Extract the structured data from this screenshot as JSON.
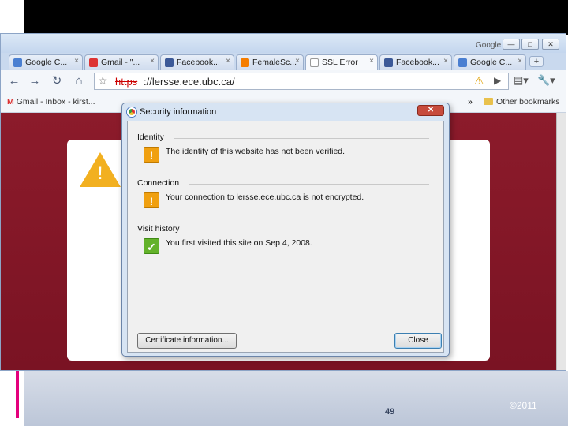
{
  "slide": {
    "number": "49",
    "copyright": "©2011"
  },
  "window": {
    "title_label": "Google",
    "controls": [
      "—",
      "□",
      "✕"
    ]
  },
  "tabs": [
    {
      "label": "Google C...",
      "favicon_color": "#4a7fd1"
    },
    {
      "label": "Gmail - \"...",
      "favicon_color": "#d33"
    },
    {
      "label": "Facebook...",
      "favicon_color": "#3b5998"
    },
    {
      "label": "FemaleSc...",
      "favicon_color": "#f57d00"
    },
    {
      "label": "SSL Error",
      "favicon_color": "#999999",
      "active": true
    },
    {
      "label": "Facebook...",
      "favicon_color": "#3b5998"
    },
    {
      "label": "Google C...",
      "favicon_color": "#4a7fd1"
    }
  ],
  "toolbar": {
    "back": "←",
    "forward": "→",
    "reload": "↻",
    "home": "⌂",
    "url_protocol": "https",
    "url_rest": "://lersse.ece.ubc.ca/",
    "page_menu": "▤▾",
    "wrench": "🔧▾"
  },
  "bookmarks": {
    "gmail": "Gmail - Inbox - kirst...",
    "more": "»",
    "other": "Other bookmarks"
  },
  "dialog": {
    "title": "Security information",
    "close": "✕",
    "sections": [
      {
        "heading": "Identity",
        "text": "The identity of this website has not been verified.",
        "status": "warning"
      },
      {
        "heading": "Connection",
        "text": "Your connection to lersse.ece.ubc.ca is not encrypted.",
        "status": "warning"
      },
      {
        "heading": "Visit history",
        "text": "You first visited this site on Sep 4, 2008.",
        "status": "ok"
      }
    ],
    "certificate_button": "Certificate information...",
    "close_button": "Close"
  },
  "colors": {
    "error_background": "#8c1b2b",
    "warning": "#f0a010",
    "ok": "#63b22a"
  }
}
